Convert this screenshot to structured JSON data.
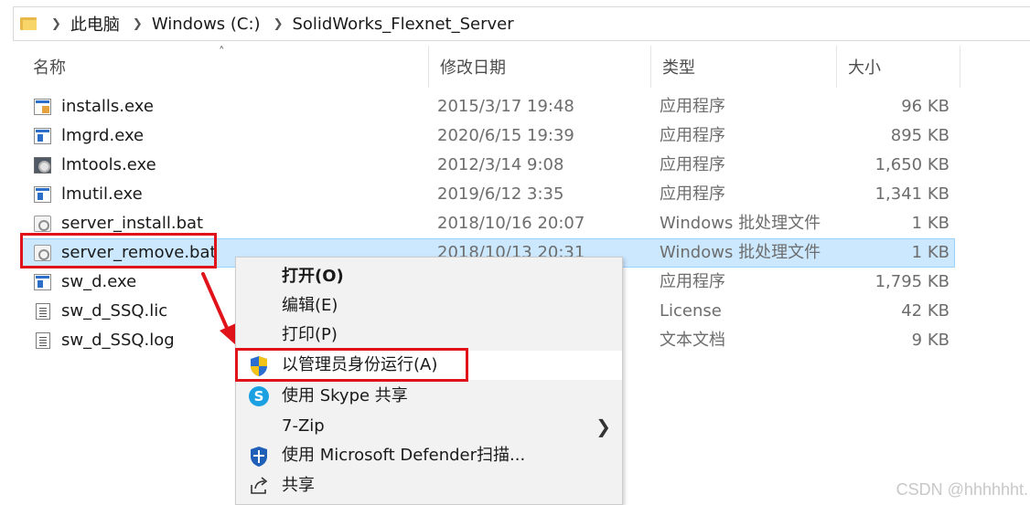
{
  "breadcrumb": [
    "此电脑",
    "Windows (C:)",
    "SolidWorks_Flexnet_Server"
  ],
  "columns": {
    "name": "名称",
    "date": "修改日期",
    "type": "类型",
    "size": "大小"
  },
  "files": [
    {
      "name": "installs.exe",
      "date": "2015/3/17 19:48",
      "type": "应用程序",
      "size": "96 KB",
      "icon": "installer-exe-icon"
    },
    {
      "name": "lmgrd.exe",
      "date": "2020/6/15 19:39",
      "type": "应用程序",
      "size": "895 KB",
      "icon": "exe-icon"
    },
    {
      "name": "lmtools.exe",
      "date": "2012/3/14 9:08",
      "type": "应用程序",
      "size": "1,650 KB",
      "icon": "lmtools-exe-icon"
    },
    {
      "name": "lmutil.exe",
      "date": "2019/6/12 3:35",
      "type": "应用程序",
      "size": "1,341 KB",
      "icon": "exe-icon"
    },
    {
      "name": "server_install.bat",
      "date": "2018/10/16 20:07",
      "type": "Windows 批处理文件",
      "size": "1 KB",
      "icon": "batch-file-icon"
    },
    {
      "name": "server_remove.bat",
      "date": "2018/10/13 20:31",
      "type": "Windows 批处理文件",
      "size": "1 KB",
      "icon": "batch-file-icon",
      "selected": true
    },
    {
      "name": "sw_d.exe",
      "date": "",
      "type": "应用程序",
      "size": "1,795 KB",
      "icon": "exe-icon"
    },
    {
      "name": "sw_d_SSQ.lic",
      "date": "",
      "type": "License",
      "size": "42 KB",
      "icon": "license-file-icon"
    },
    {
      "name": "sw_d_SSQ.log",
      "date": "",
      "type": "文本文档",
      "size": "9 KB",
      "icon": "text-file-icon"
    }
  ],
  "context_menu": [
    {
      "label": "打开(O)",
      "bold": true,
      "icon": ""
    },
    {
      "label": "编辑(E)",
      "icon": ""
    },
    {
      "label": "打印(P)",
      "icon": ""
    },
    {
      "label": "以管理员身份运行(A)",
      "icon": "uac-shield-icon",
      "highlighted": true
    },
    {
      "label": "使用 Skype 共享",
      "icon": "skype-icon"
    },
    {
      "label": "7-Zip",
      "icon": "",
      "submenu": true
    },
    {
      "label": "使用 Microsoft Defender扫描...",
      "icon": "defender-shield-icon"
    },
    {
      "label": "共享",
      "icon": "share-icon"
    }
  ],
  "colors": {
    "annotation_red": "#e0121a",
    "selection_bg": "#cce8ff",
    "selection_border": "#99d1ff"
  },
  "watermark": "CSDN @hhhhhht."
}
